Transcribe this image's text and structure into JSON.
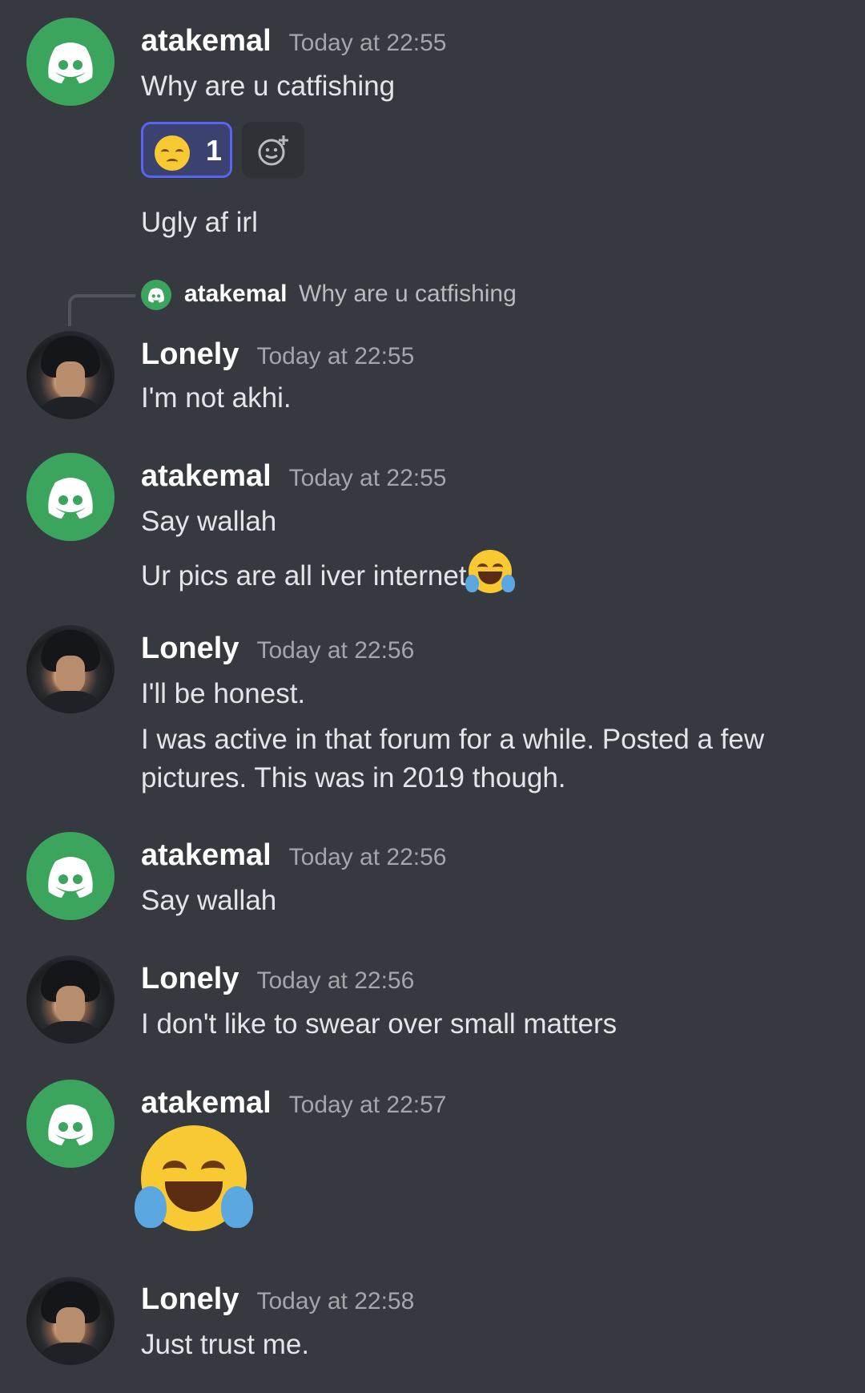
{
  "messages": [
    {
      "user": "atakemal",
      "time": "Today at 22:55",
      "lines": [
        "Why are u catfishing",
        "Ugly af irl"
      ],
      "reaction": {
        "emoji": "pensive-face",
        "count": "1"
      }
    },
    {
      "user": "Lonely",
      "time": "Today at 22:55",
      "reply": {
        "user": "atakemal",
        "text": "Why are u catfishing"
      },
      "lines": [
        "I'm not akhi."
      ]
    },
    {
      "user": "atakemal",
      "time": "Today at 22:55",
      "lines": [
        "Say wallah",
        "Ur pics are all iver internet"
      ]
    },
    {
      "user": "Lonely",
      "time": "Today at 22:56",
      "lines": [
        "I'll be honest.",
        "I was active in that forum for a while. Posted a few",
        "pictures. This was in 2019 though."
      ]
    },
    {
      "user": "atakemal",
      "time": "Today at 22:56",
      "lines": [
        "Say wallah"
      ]
    },
    {
      "user": "Lonely",
      "time": "Today at 22:56",
      "lines": [
        "I don't like to swear over small matters"
      ]
    },
    {
      "user": "atakemal",
      "time": "Today at 22:57",
      "emoji": "face-with-tears-of-joy"
    },
    {
      "user": "Lonely",
      "time": "Today at 22:58",
      "lines": [
        "Just trust me."
      ]
    }
  ],
  "colors": {
    "background": "#36393f",
    "discord_green": "#3ba55d",
    "reaction_border": "#5865f2",
    "timestamp": "#a3a6aa"
  }
}
